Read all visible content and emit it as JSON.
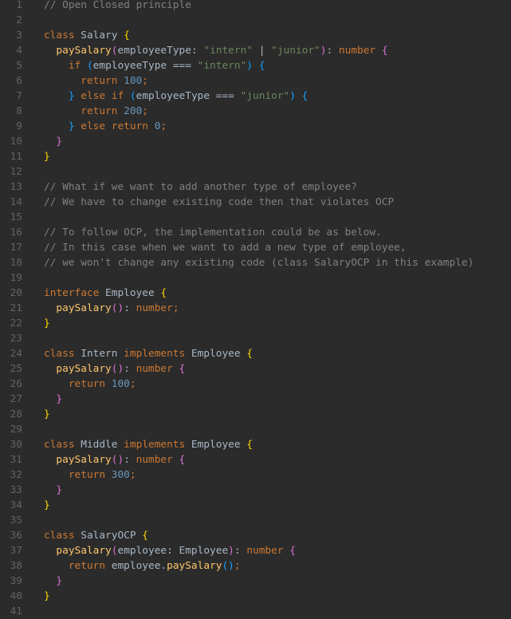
{
  "editor": {
    "lines": [
      [
        [
          "c",
          "// Open Closed principle"
        ]
      ],
      [],
      [
        [
          "k",
          "class "
        ],
        [
          "i",
          "Salary "
        ],
        [
          "b1",
          "{"
        ]
      ],
      [
        [
          "i",
          "  "
        ],
        [
          "f",
          "paySalary"
        ],
        [
          "b2",
          "("
        ],
        [
          "i",
          "employeeType: "
        ],
        [
          "s",
          "\"intern\""
        ],
        [
          "i",
          " | "
        ],
        [
          "s",
          "\"junior\""
        ],
        [
          "b2",
          ")"
        ],
        [
          "i",
          ": "
        ],
        [
          "k",
          "number "
        ],
        [
          "b2",
          "{"
        ]
      ],
      [
        [
          "i",
          "    "
        ],
        [
          "k",
          "if "
        ],
        [
          "b3",
          "("
        ],
        [
          "i",
          "employeeType === "
        ],
        [
          "s",
          "\"intern\""
        ],
        [
          "b3",
          ")"
        ],
        [
          "i",
          " "
        ],
        [
          "b3",
          "{"
        ]
      ],
      [
        [
          "i",
          "      "
        ],
        [
          "k",
          "return "
        ],
        [
          "n",
          "100"
        ],
        [
          "k",
          ";"
        ]
      ],
      [
        [
          "i",
          "    "
        ],
        [
          "b3",
          "}"
        ],
        [
          "k",
          " else if "
        ],
        [
          "b3",
          "("
        ],
        [
          "i",
          "employeeType === "
        ],
        [
          "s",
          "\"junior\""
        ],
        [
          "b3",
          ")"
        ],
        [
          "i",
          " "
        ],
        [
          "b3",
          "{"
        ]
      ],
      [
        [
          "i",
          "      "
        ],
        [
          "k",
          "return "
        ],
        [
          "n",
          "200"
        ],
        [
          "k",
          ";"
        ]
      ],
      [
        [
          "i",
          "    "
        ],
        [
          "b3",
          "}"
        ],
        [
          "k",
          " else return "
        ],
        [
          "n",
          "0"
        ],
        [
          "k",
          ";"
        ]
      ],
      [
        [
          "i",
          "  "
        ],
        [
          "b2",
          "}"
        ]
      ],
      [
        [
          "b1",
          "}"
        ]
      ],
      [],
      [
        [
          "c",
          "// What if we want to add another type of employee?"
        ]
      ],
      [
        [
          "c",
          "// We have to change existing code then that violates OCP"
        ]
      ],
      [],
      [
        [
          "c",
          "// To follow OCP, the implementation could be as below."
        ]
      ],
      [
        [
          "c",
          "// In this case when we want to add a new type of employee,"
        ]
      ],
      [
        [
          "c",
          "// we won't change any existing code (class SalaryOCP in this example)"
        ]
      ],
      [],
      [
        [
          "k",
          "interface "
        ],
        [
          "i",
          "Employee "
        ],
        [
          "b1",
          "{"
        ]
      ],
      [
        [
          "i",
          "  "
        ],
        [
          "f",
          "paySalary"
        ],
        [
          "b2",
          "()"
        ],
        [
          "i",
          ": "
        ],
        [
          "k",
          "number;"
        ]
      ],
      [
        [
          "b1",
          "}"
        ]
      ],
      [],
      [
        [
          "k",
          "class "
        ],
        [
          "i",
          "Intern "
        ],
        [
          "k",
          "implements "
        ],
        [
          "i",
          "Employee "
        ],
        [
          "b1",
          "{"
        ]
      ],
      [
        [
          "i",
          "  "
        ],
        [
          "f",
          "paySalary"
        ],
        [
          "b2",
          "()"
        ],
        [
          "i",
          ": "
        ],
        [
          "k",
          "number "
        ],
        [
          "b2",
          "{"
        ]
      ],
      [
        [
          "i",
          "    "
        ],
        [
          "k",
          "return "
        ],
        [
          "n",
          "100"
        ],
        [
          "k",
          ";"
        ]
      ],
      [
        [
          "i",
          "  "
        ],
        [
          "b2",
          "}"
        ]
      ],
      [
        [
          "b1",
          "}"
        ]
      ],
      [],
      [
        [
          "k",
          "class "
        ],
        [
          "i",
          "Middle "
        ],
        [
          "k",
          "implements "
        ],
        [
          "i",
          "Employee "
        ],
        [
          "b1",
          "{"
        ]
      ],
      [
        [
          "i",
          "  "
        ],
        [
          "f",
          "paySalary"
        ],
        [
          "b2",
          "()"
        ],
        [
          "i",
          ": "
        ],
        [
          "k",
          "number "
        ],
        [
          "b2",
          "{"
        ]
      ],
      [
        [
          "i",
          "    "
        ],
        [
          "k",
          "return "
        ],
        [
          "n",
          "300"
        ],
        [
          "k",
          ";"
        ]
      ],
      [
        [
          "i",
          "  "
        ],
        [
          "b2",
          "}"
        ]
      ],
      [
        [
          "b1",
          "}"
        ]
      ],
      [],
      [
        [
          "k",
          "class "
        ],
        [
          "i",
          "SalaryOCP "
        ],
        [
          "b1",
          "{"
        ]
      ],
      [
        [
          "i",
          "  "
        ],
        [
          "f",
          "paySalary"
        ],
        [
          "b2",
          "("
        ],
        [
          "i",
          "employee: Employee"
        ],
        [
          "b2",
          ")"
        ],
        [
          "i",
          ": "
        ],
        [
          "k",
          "number "
        ],
        [
          "b2",
          "{"
        ]
      ],
      [
        [
          "i",
          "    "
        ],
        [
          "k",
          "return "
        ],
        [
          "i",
          "employee."
        ],
        [
          "f",
          "paySalary"
        ],
        [
          "b3",
          "()"
        ],
        [
          "k",
          ";"
        ]
      ],
      [
        [
          "i",
          "  "
        ],
        [
          "b2",
          "}"
        ]
      ],
      [
        [
          "b1",
          "}"
        ]
      ],
      []
    ]
  }
}
